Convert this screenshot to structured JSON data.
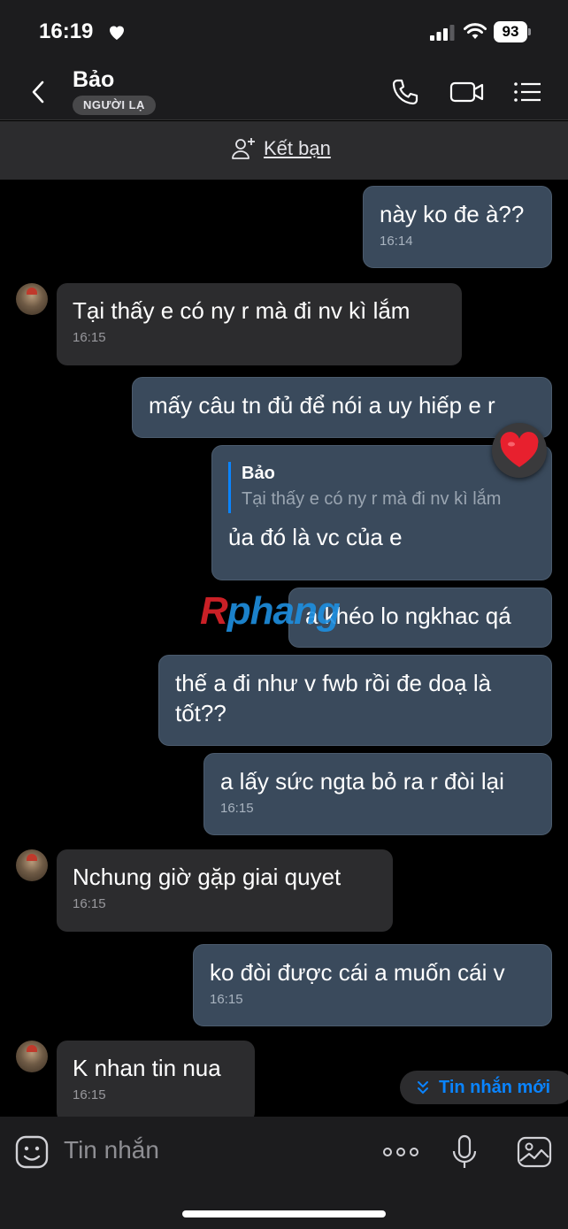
{
  "status_bar": {
    "time": "16:19",
    "battery": "93"
  },
  "header": {
    "name": "Bảo",
    "badge": "NGƯỜI LẠ"
  },
  "friend_bar": {
    "label": "Kết bạn"
  },
  "messages": [
    {
      "dir": "out",
      "text": "này ko đe à??",
      "time": "16:14"
    },
    {
      "dir": "in",
      "text": "Tại thấy e có ny r mà đi nv kì lắm",
      "time": "16:15"
    },
    {
      "dir": "out",
      "text": "mấy câu tn đủ để nói a uy hiếp e r",
      "time": ""
    },
    {
      "dir": "out",
      "quote_name": "Bảo",
      "quote_text": "Tại thấy e có ny r mà đi nv kì lắm",
      "text": "ủa đó là vc của e",
      "time": ""
    },
    {
      "dir": "out",
      "text": "a khéo lo ngkhac qá",
      "time": ""
    },
    {
      "dir": "out",
      "text": "thế a đi như v fwb rồi đe doạ là tốt??",
      "time": ""
    },
    {
      "dir": "out",
      "text": "a lấy sức ngta bỏ ra r đòi lại",
      "time": "16:15"
    },
    {
      "dir": "in",
      "text": "Nchung giờ gặp giai quyet",
      "time": "16:15"
    },
    {
      "dir": "out",
      "text": "ko đòi được cái a muốn cái v",
      "time": "16:15"
    },
    {
      "dir": "in",
      "text": "K nhan tin nua",
      "time": "16:15"
    }
  ],
  "watermark": {
    "prefix": "R",
    "rest": "phang"
  },
  "new_messages_label": "Tin nhắn mới",
  "composer": {
    "placeholder": "Tin nhắn"
  },
  "colors": {
    "accent": "#0a84ff",
    "outgoing_bubble": "#3a4a5c",
    "incoming_bubble": "#2c2c2e",
    "reaction": "#e8202e"
  }
}
